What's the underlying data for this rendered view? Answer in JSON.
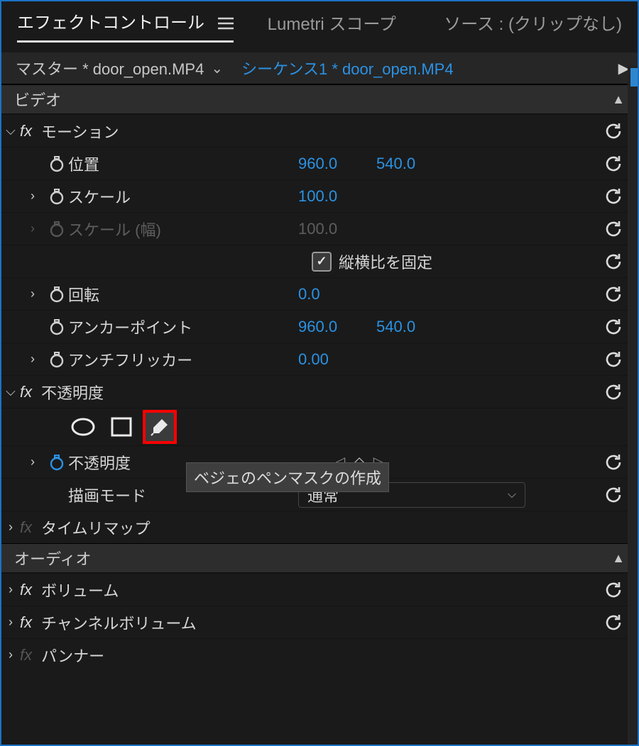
{
  "tabs": {
    "effect_controls": "エフェクトコントロール",
    "lumetri": "Lumetri スコープ",
    "source": "ソース : (クリップなし)"
  },
  "clipbar": {
    "master": "マスター * door_open.MP4",
    "sequence": "シーケンス1 * door_open.MP4"
  },
  "sections": {
    "video": "ビデオ",
    "audio": "オーディオ"
  },
  "effects": {
    "motion": {
      "name": "モーション",
      "position": {
        "label": "位置",
        "x": "960.0",
        "y": "540.0"
      },
      "scale": {
        "label": "スケール",
        "value": "100.0"
      },
      "scale_w": {
        "label": "スケール (幅)",
        "value": "100.0"
      },
      "uniform": {
        "label": "縦横比を固定"
      },
      "rotation": {
        "label": "回転",
        "value": "0.0"
      },
      "anchor": {
        "label": "アンカーポイント",
        "x": "960.0",
        "y": "540.0"
      },
      "antiflicker": {
        "label": "アンチフリッカー",
        "value": "0.00"
      }
    },
    "opacity": {
      "name": "不透明度",
      "opacity": {
        "label": "不透明度"
      },
      "blend": {
        "label": "描画モード",
        "value": "通常"
      },
      "tooltip": "ベジェのペンマスクの作成"
    },
    "time_remap": {
      "name": "タイムリマップ"
    },
    "volume": {
      "name": "ボリューム"
    },
    "channel_volume": {
      "name": "チャンネルボリューム"
    },
    "panner": {
      "name": "パンナー"
    }
  }
}
